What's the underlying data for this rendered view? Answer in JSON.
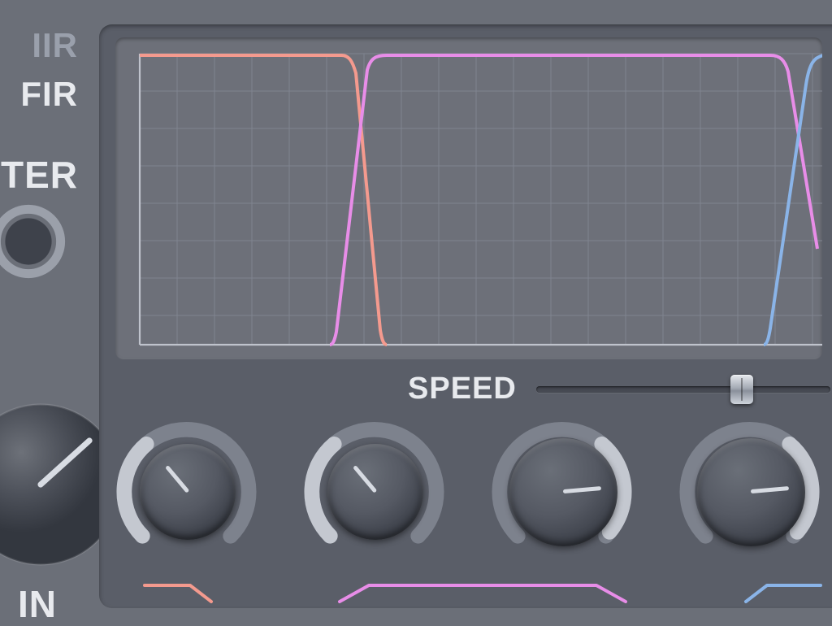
{
  "left_panel": {
    "iir_label": "IIR",
    "fir_label": "FIR",
    "ter_label": "TER",
    "in_label": "IN",
    "ter_knob": {
      "angle_deg": 0
    },
    "gain_knob": {
      "angle_deg": 50
    }
  },
  "graph": {
    "filters": [
      {
        "name": "band1-lowpass",
        "color": "salmon"
      },
      {
        "name": "band2-bandpass",
        "color": "pink"
      },
      {
        "name": "band3-highpass",
        "color": "blue"
      }
    ]
  },
  "speed": {
    "label": "SPEED",
    "slider_value_pct": 70
  },
  "knobs": [
    {
      "name": "band1-freq-knob",
      "angle_deg": -40,
      "fill_start_deg": -135,
      "fill_end_deg": -40,
      "body_pct": 62
    },
    {
      "name": "band2-low-knob",
      "angle_deg": -40,
      "fill_start_deg": -135,
      "fill_end_deg": -40,
      "body_pct": 62
    },
    {
      "name": "band2-high-knob",
      "angle_deg": 85,
      "fill_start_deg": 130,
      "fill_end_deg": 40,
      "body_pct": 70
    },
    {
      "name": "band3-freq-knob",
      "angle_deg": 85,
      "fill_start_deg": 130,
      "fill_end_deg": 40,
      "body_pct": 70
    }
  ],
  "band_shapes": [
    {
      "name": "band1-shape-icon",
      "color": "salmon",
      "type": "lowpass"
    },
    {
      "name": "band2-shape-icon",
      "color": "pink",
      "type": "bandpass"
    },
    {
      "name": "band3-shape-icon",
      "color": "blue",
      "type": "highpass"
    }
  ],
  "colors": {
    "salmon": "#f49a8e",
    "pink": "#e88de8",
    "blue": "#8ab4e8",
    "panel": "#5a5e68",
    "bg": "#6b6f78"
  }
}
